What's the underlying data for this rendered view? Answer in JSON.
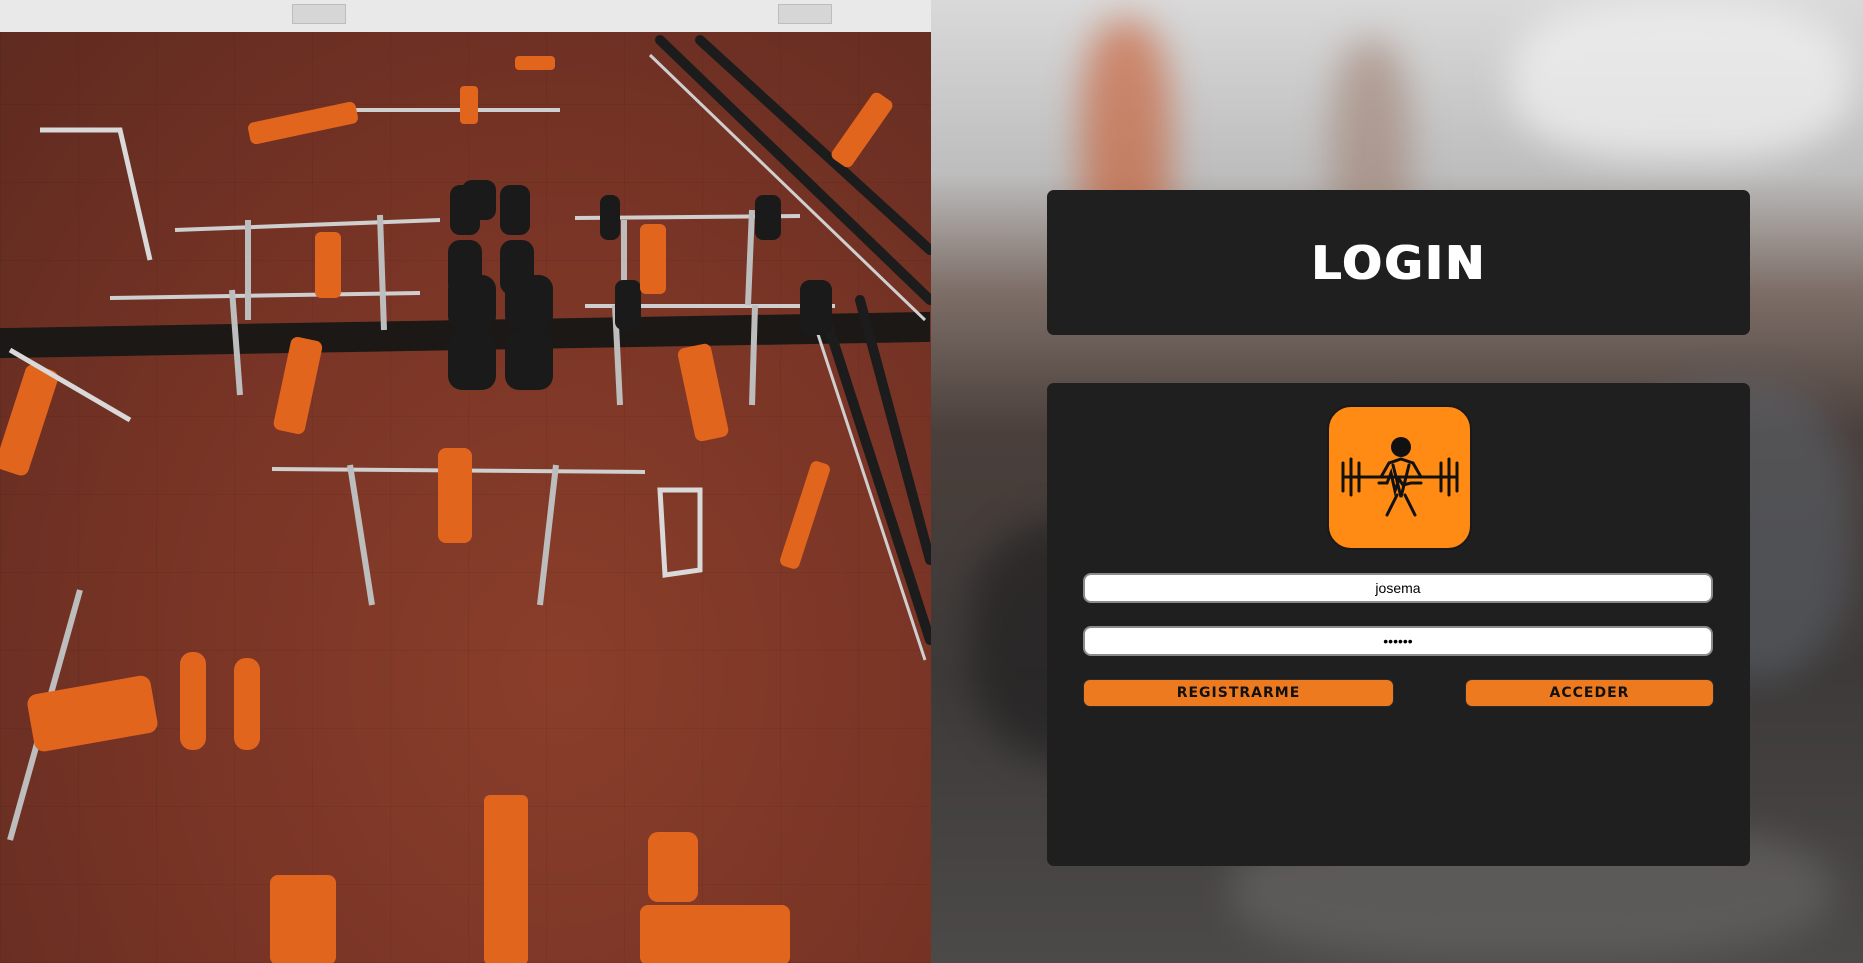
{
  "login": {
    "title": "LOGIN",
    "logo_icon": "weightlifter-icon",
    "username_value": "josema",
    "password_value": "••••••",
    "register_label": "REGISTRARME",
    "access_label": "ACCEDER"
  },
  "colors": {
    "accent": "#ee7a1f",
    "logo_bg": "#ff8a14",
    "panel_bg": "#1f1f1f",
    "field_bg": "#ffffff"
  }
}
